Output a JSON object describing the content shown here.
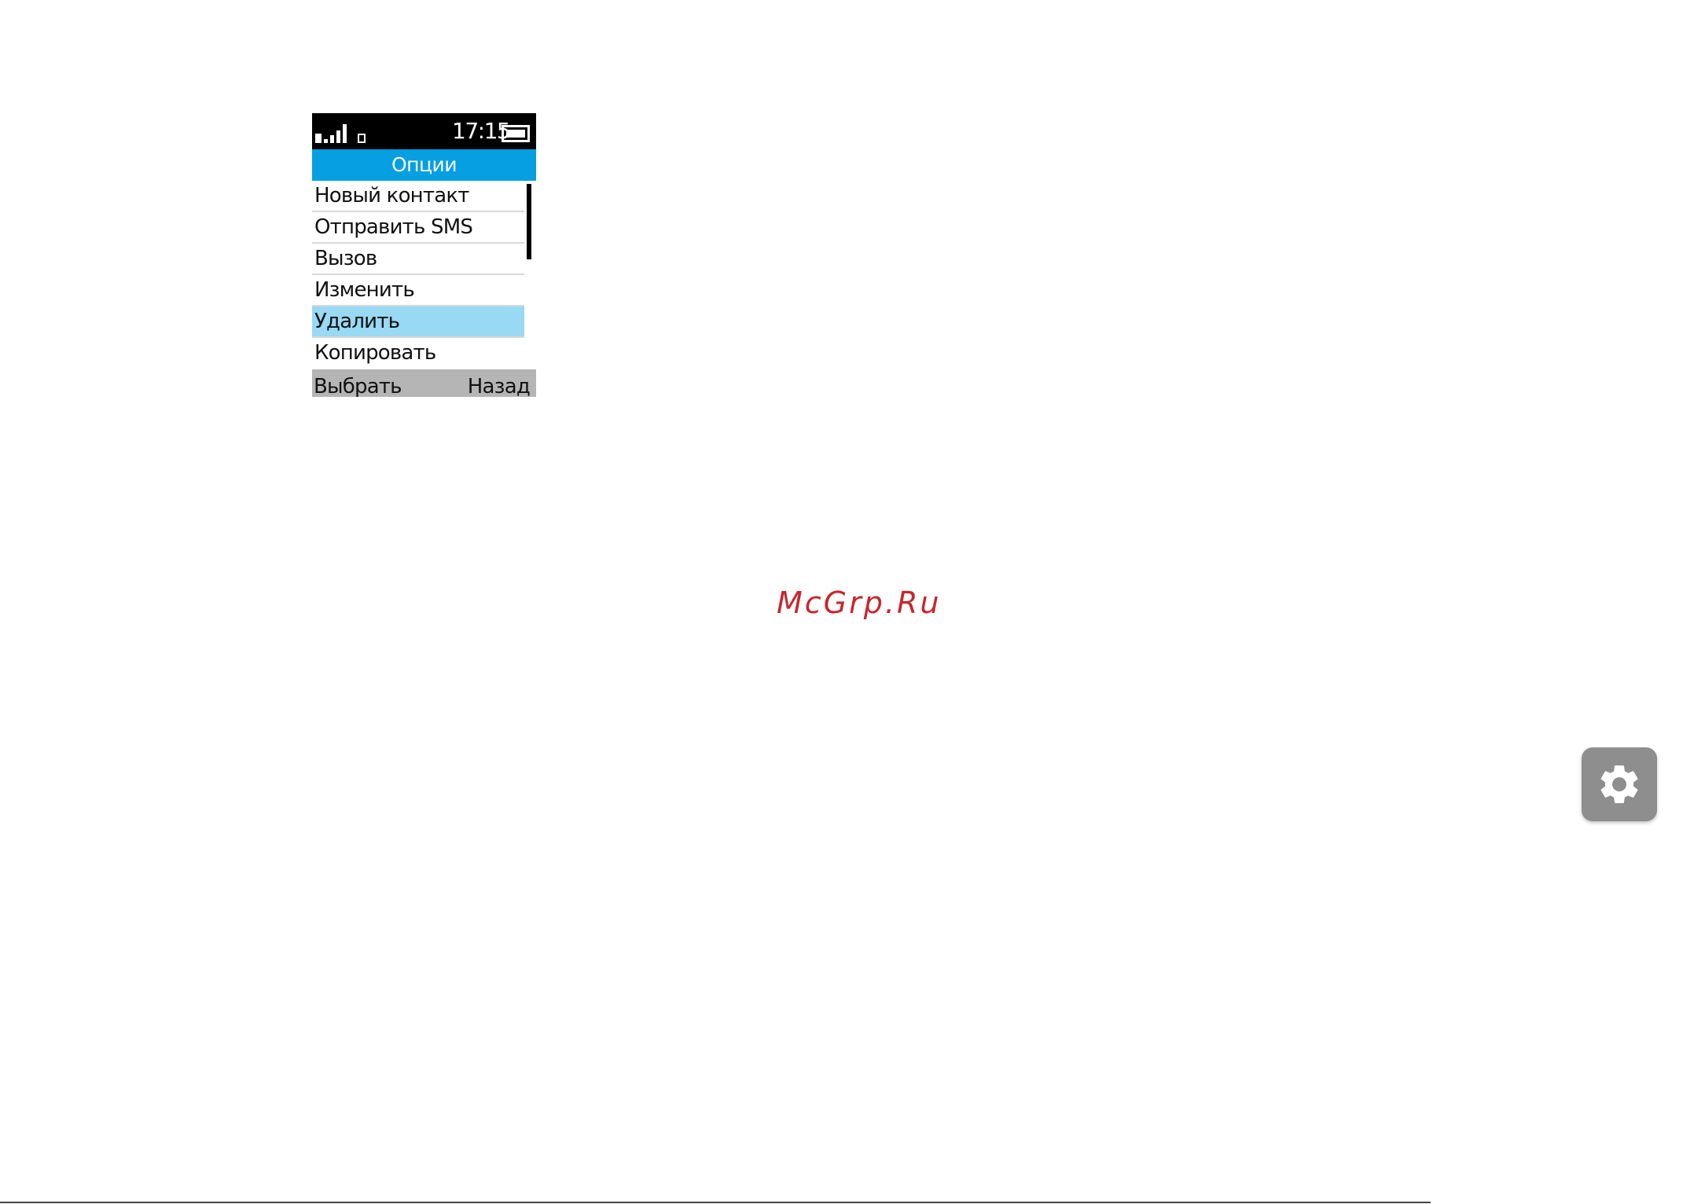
{
  "status_bar": {
    "time": "17:15"
  },
  "screen": {
    "title": "Опции",
    "menu_items": [
      {
        "label": "Новый контакт"
      },
      {
        "label": "Отправить SMS"
      },
      {
        "label": "Вызов"
      },
      {
        "label": "Изменить"
      },
      {
        "label": "Удалить",
        "selected": true
      },
      {
        "label": "Копировать"
      }
    ],
    "softkeys": {
      "left": "Выбрать",
      "right": "Назад"
    }
  },
  "watermark": "McGrp.Ru",
  "colors": {
    "title_bar": "#069fe2",
    "selected_item": "#98d9f4",
    "softkey_bar": "#b5b5b5",
    "watermark": "#c8262e",
    "settings_button": "#8e8e8e"
  },
  "icons": {
    "signal": "signal-strength-icon",
    "sim": "sim-card-icon",
    "battery": "battery-icon",
    "settings": "gear-icon"
  }
}
